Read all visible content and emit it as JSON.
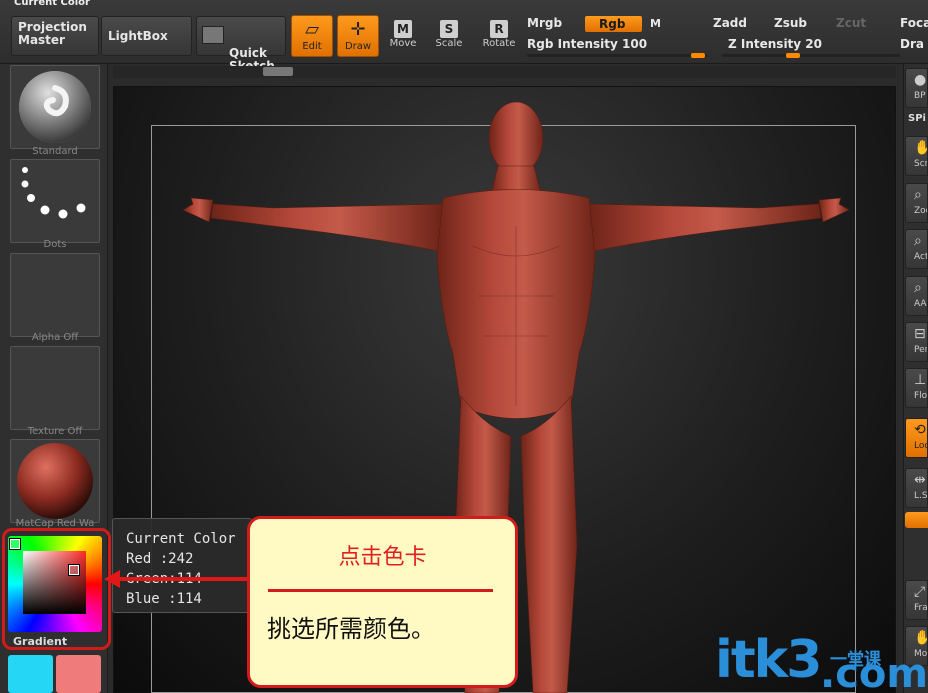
{
  "window": {
    "title": "Current Color"
  },
  "toolbar": {
    "projection_master": "Projection\nMaster",
    "lightbox": "LightBox",
    "quick_sketch": "Quick\nSketch",
    "edit": "Edit",
    "draw": "Draw",
    "move": "Move",
    "scale": "Scale",
    "rotate": "Rotate",
    "move_key": "M",
    "scale_key": "S",
    "rotate_key": "R",
    "mrgb": "Mrgb",
    "rgb": "Rgb",
    "m": "M",
    "zadd": "Zadd",
    "zsub": "Zsub",
    "zcut": "Zcut",
    "rgb_intensity": "Rgb Intensity 100",
    "z_intensity": "Z Intensity 20",
    "focal": "Foca",
    "draw_size": "Dra",
    "rgb_intensity_value": 100,
    "z_intensity_value": 20
  },
  "left_panel": {
    "brush_label": "Standard",
    "stroke_label": "Dots",
    "alpha_label": "Alpha  Off",
    "texture_label": "Texture  Off",
    "material_label": "MatCap Red Wa",
    "gradient_label": "Gradient",
    "swatch_main": "#25d6f5",
    "swatch_secondary": "#f07b7b"
  },
  "tooltip": {
    "title": "Current Color",
    "red": "Red   :242",
    "green": "Green:114",
    "blue": "Blue :114"
  },
  "callout": {
    "title": "点击色卡",
    "body": "挑选所需颜色。"
  },
  "right_panel": {
    "items": [
      "BP",
      "SPi",
      "Scr",
      "Zoo",
      "Act",
      "AAH",
      "Per",
      "Flo",
      "Loc",
      "L.Sy",
      "Fra",
      "Mo"
    ]
  },
  "watermark": {
    "main": "itk3",
    "domain": ".com",
    "sub": "一堂课"
  }
}
